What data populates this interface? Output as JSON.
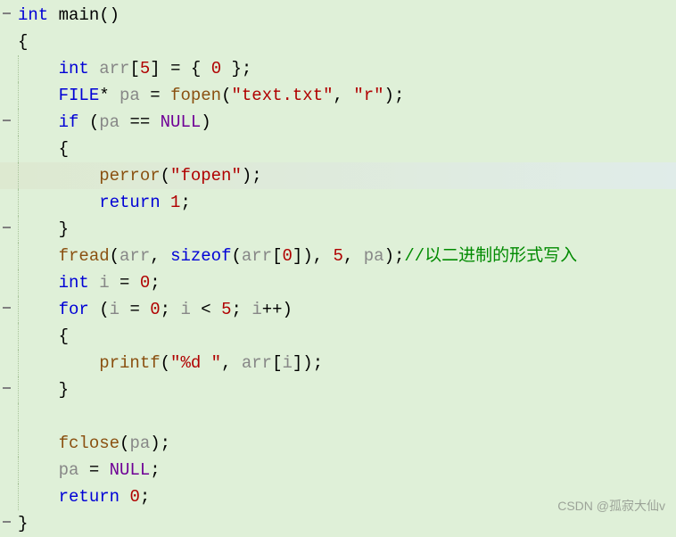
{
  "editor": {
    "lines": [
      {
        "fold": true,
        "hl": false,
        "indent": 0,
        "segs": [
          {
            "c": "tok-type",
            "t": "int"
          },
          {
            "c": "tok-punct",
            "t": " "
          },
          {
            "c": "tok-userfunc",
            "t": "main"
          },
          {
            "c": "tok-punct",
            "t": "()"
          }
        ]
      },
      {
        "fold": false,
        "hl": false,
        "indent": 0,
        "segs": [
          {
            "c": "tok-punct",
            "t": "{"
          }
        ]
      },
      {
        "fold": false,
        "hl": false,
        "indent": 1,
        "segs": [
          {
            "c": "tok-punct",
            "t": "    "
          },
          {
            "c": "tok-type",
            "t": "int"
          },
          {
            "c": "tok-punct",
            "t": " "
          },
          {
            "c": "tok-ident",
            "t": "arr"
          },
          {
            "c": "tok-punct",
            "t": "["
          },
          {
            "c": "tok-number",
            "t": "5"
          },
          {
            "c": "tok-punct",
            "t": "] = { "
          },
          {
            "c": "tok-number",
            "t": "0"
          },
          {
            "c": "tok-punct",
            "t": " };"
          }
        ]
      },
      {
        "fold": false,
        "hl": false,
        "indent": 1,
        "segs": [
          {
            "c": "tok-punct",
            "t": "    "
          },
          {
            "c": "tok-type",
            "t": "FILE"
          },
          {
            "c": "tok-punct",
            "t": "* "
          },
          {
            "c": "tok-ident",
            "t": "pa"
          },
          {
            "c": "tok-punct",
            "t": " = "
          },
          {
            "c": "tok-func",
            "t": "fopen"
          },
          {
            "c": "tok-punct",
            "t": "("
          },
          {
            "c": "tok-string",
            "t": "\"text.txt\""
          },
          {
            "c": "tok-punct",
            "t": ", "
          },
          {
            "c": "tok-string",
            "t": "\"r\""
          },
          {
            "c": "tok-punct",
            "t": ");"
          }
        ]
      },
      {
        "fold": true,
        "hl": false,
        "indent": 1,
        "segs": [
          {
            "c": "tok-punct",
            "t": "    "
          },
          {
            "c": "tok-keyword",
            "t": "if"
          },
          {
            "c": "tok-punct",
            "t": " ("
          },
          {
            "c": "tok-ident",
            "t": "pa"
          },
          {
            "c": "tok-punct",
            "t": " == "
          },
          {
            "c": "tok-macro",
            "t": "NULL"
          },
          {
            "c": "tok-punct",
            "t": ")"
          }
        ]
      },
      {
        "fold": false,
        "hl": false,
        "indent": 1,
        "segs": [
          {
            "c": "tok-punct",
            "t": "    {"
          }
        ]
      },
      {
        "fold": false,
        "hl": true,
        "indent": 2,
        "segs": [
          {
            "c": "tok-punct",
            "t": "        "
          },
          {
            "c": "tok-func",
            "t": "perror"
          },
          {
            "c": "tok-punct",
            "t": "("
          },
          {
            "c": "tok-string",
            "t": "\"fopen\""
          },
          {
            "c": "tok-punct",
            "t": ");"
          }
        ]
      },
      {
        "fold": false,
        "hl": false,
        "indent": 2,
        "segs": [
          {
            "c": "tok-punct",
            "t": "        "
          },
          {
            "c": "tok-keyword",
            "t": "return"
          },
          {
            "c": "tok-punct",
            "t": " "
          },
          {
            "c": "tok-number",
            "t": "1"
          },
          {
            "c": "tok-punct",
            "t": ";"
          }
        ]
      },
      {
        "fold": true,
        "hl": false,
        "indent": 1,
        "segs": [
          {
            "c": "tok-punct",
            "t": "    }"
          }
        ]
      },
      {
        "fold": false,
        "hl": false,
        "indent": 1,
        "segs": [
          {
            "c": "tok-punct",
            "t": "    "
          },
          {
            "c": "tok-func",
            "t": "fread"
          },
          {
            "c": "tok-punct",
            "t": "("
          },
          {
            "c": "tok-ident",
            "t": "arr"
          },
          {
            "c": "tok-punct",
            "t": ", "
          },
          {
            "c": "tok-keyword",
            "t": "sizeof"
          },
          {
            "c": "tok-punct",
            "t": "("
          },
          {
            "c": "tok-ident",
            "t": "arr"
          },
          {
            "c": "tok-punct",
            "t": "["
          },
          {
            "c": "tok-number",
            "t": "0"
          },
          {
            "c": "tok-punct",
            "t": "]), "
          },
          {
            "c": "tok-number",
            "t": "5"
          },
          {
            "c": "tok-punct",
            "t": ", "
          },
          {
            "c": "tok-ident",
            "t": "pa"
          },
          {
            "c": "tok-punct",
            "t": ");"
          },
          {
            "c": "tok-comment",
            "t": "//以二进制的形式写入"
          }
        ]
      },
      {
        "fold": false,
        "hl": false,
        "indent": 1,
        "segs": [
          {
            "c": "tok-punct",
            "t": "    "
          },
          {
            "c": "tok-type",
            "t": "int"
          },
          {
            "c": "tok-punct",
            "t": " "
          },
          {
            "c": "tok-ident",
            "t": "i"
          },
          {
            "c": "tok-punct",
            "t": " = "
          },
          {
            "c": "tok-number",
            "t": "0"
          },
          {
            "c": "tok-punct",
            "t": ";"
          }
        ]
      },
      {
        "fold": true,
        "hl": false,
        "indent": 1,
        "segs": [
          {
            "c": "tok-punct",
            "t": "    "
          },
          {
            "c": "tok-keyword",
            "t": "for"
          },
          {
            "c": "tok-punct",
            "t": " ("
          },
          {
            "c": "tok-ident",
            "t": "i"
          },
          {
            "c": "tok-punct",
            "t": " = "
          },
          {
            "c": "tok-number",
            "t": "0"
          },
          {
            "c": "tok-punct",
            "t": "; "
          },
          {
            "c": "tok-ident",
            "t": "i"
          },
          {
            "c": "tok-punct",
            "t": " < "
          },
          {
            "c": "tok-number",
            "t": "5"
          },
          {
            "c": "tok-punct",
            "t": "; "
          },
          {
            "c": "tok-ident",
            "t": "i"
          },
          {
            "c": "tok-punct",
            "t": "++)"
          }
        ]
      },
      {
        "fold": false,
        "hl": false,
        "indent": 1,
        "segs": [
          {
            "c": "tok-punct",
            "t": "    {"
          }
        ]
      },
      {
        "fold": false,
        "hl": false,
        "indent": 2,
        "segs": [
          {
            "c": "tok-punct",
            "t": "        "
          },
          {
            "c": "tok-func",
            "t": "printf"
          },
          {
            "c": "tok-punct",
            "t": "("
          },
          {
            "c": "tok-string",
            "t": "\"%d \""
          },
          {
            "c": "tok-punct",
            "t": ", "
          },
          {
            "c": "tok-ident",
            "t": "arr"
          },
          {
            "c": "tok-punct",
            "t": "["
          },
          {
            "c": "tok-ident",
            "t": "i"
          },
          {
            "c": "tok-punct",
            "t": "]);"
          }
        ]
      },
      {
        "fold": true,
        "hl": false,
        "indent": 1,
        "segs": [
          {
            "c": "tok-punct",
            "t": "    }"
          }
        ]
      },
      {
        "fold": false,
        "hl": false,
        "indent": 1,
        "segs": [
          {
            "c": "tok-punct",
            "t": ""
          }
        ]
      },
      {
        "fold": false,
        "hl": false,
        "indent": 1,
        "segs": [
          {
            "c": "tok-punct",
            "t": "    "
          },
          {
            "c": "tok-func",
            "t": "fclose"
          },
          {
            "c": "tok-punct",
            "t": "("
          },
          {
            "c": "tok-ident",
            "t": "pa"
          },
          {
            "c": "tok-punct",
            "t": ");"
          }
        ]
      },
      {
        "fold": false,
        "hl": false,
        "indent": 1,
        "segs": [
          {
            "c": "tok-punct",
            "t": "    "
          },
          {
            "c": "tok-ident",
            "t": "pa"
          },
          {
            "c": "tok-punct",
            "t": " = "
          },
          {
            "c": "tok-macro",
            "t": "NULL"
          },
          {
            "c": "tok-punct",
            "t": ";"
          }
        ]
      },
      {
        "fold": false,
        "hl": false,
        "indent": 1,
        "segs": [
          {
            "c": "tok-punct",
            "t": "    "
          },
          {
            "c": "tok-keyword",
            "t": "return"
          },
          {
            "c": "tok-punct",
            "t": " "
          },
          {
            "c": "tok-number",
            "t": "0"
          },
          {
            "c": "tok-punct",
            "t": ";"
          }
        ]
      },
      {
        "fold": true,
        "hl": false,
        "indent": 0,
        "segs": [
          {
            "c": "tok-punct",
            "t": "}"
          }
        ]
      }
    ]
  },
  "watermark": "CSDN @孤寂大仙v"
}
